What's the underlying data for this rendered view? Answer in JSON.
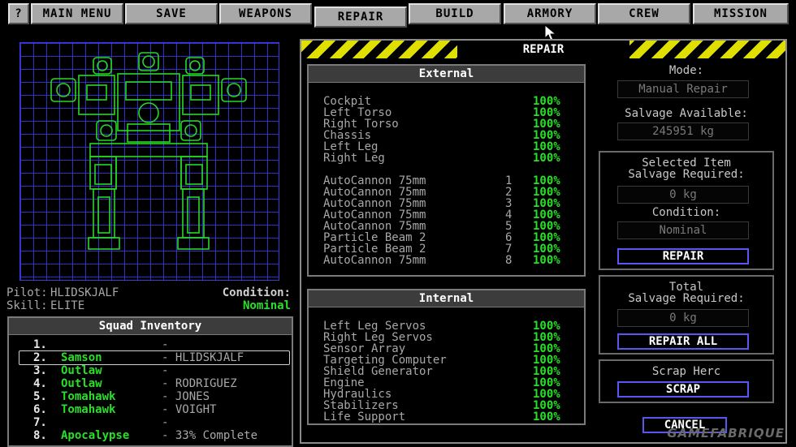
{
  "menu": {
    "help": "?",
    "items": [
      "MAIN MENU",
      "SAVE",
      "WEAPONS",
      "REPAIR",
      "BUILD",
      "ARMORY",
      "CREW",
      "MISSION"
    ]
  },
  "pilot": {
    "pilot_label": "Pilot:",
    "pilot_value": "HLIDSKJALF",
    "skill_label": "Skill:",
    "skill_value": "ELITE",
    "condition_label": "Condition:",
    "condition_value": "Nominal"
  },
  "squad": {
    "title": "Squad Inventory",
    "rows": [
      {
        "num": "1.",
        "name": "",
        "pilot": "-"
      },
      {
        "num": "2.",
        "name": "Samson",
        "pilot": "- HLIDSKJALF"
      },
      {
        "num": "3.",
        "name": "Outlaw",
        "pilot": "-"
      },
      {
        "num": "4.",
        "name": "Outlaw",
        "pilot": "- RODRIGUEZ"
      },
      {
        "num": "5.",
        "name": "Tomahawk",
        "pilot": "- JONES"
      },
      {
        "num": "6.",
        "name": "Tomahawk",
        "pilot": "- VOIGHT"
      },
      {
        "num": "7.",
        "name": "",
        "pilot": "-"
      },
      {
        "num": "8.",
        "name": "Apocalypse",
        "pilot": "- 33% Complete"
      }
    ]
  },
  "repair": {
    "title": "REPAIR",
    "external_title": "External",
    "external": [
      {
        "name": "Cockpit",
        "slot": "",
        "pct": "100%"
      },
      {
        "name": "Left Torso",
        "slot": "",
        "pct": "100%"
      },
      {
        "name": "Right Torso",
        "slot": "",
        "pct": "100%"
      },
      {
        "name": "Chassis",
        "slot": "",
        "pct": "100%"
      },
      {
        "name": "Left Leg",
        "slot": "",
        "pct": "100%"
      },
      {
        "name": "Right Leg",
        "slot": "",
        "pct": "100%"
      },
      {
        "name": "AutoCannon 75mm",
        "slot": "1",
        "pct": "100%"
      },
      {
        "name": "AutoCannon 75mm",
        "slot": "2",
        "pct": "100%"
      },
      {
        "name": "AutoCannon 75mm",
        "slot": "3",
        "pct": "100%"
      },
      {
        "name": "AutoCannon 75mm",
        "slot": "4",
        "pct": "100%"
      },
      {
        "name": "AutoCannon 75mm",
        "slot": "5",
        "pct": "100%"
      },
      {
        "name": "Particle Beam 2",
        "slot": "6",
        "pct": "100%"
      },
      {
        "name": "Particle Beam 2",
        "slot": "7",
        "pct": "100%"
      },
      {
        "name": "AutoCannon 75mm",
        "slot": "8",
        "pct": "100%"
      }
    ],
    "internal_title": "Internal",
    "internal": [
      {
        "name": "Left Leg Servos",
        "pct": "100%"
      },
      {
        "name": "Right Leg Servos",
        "pct": "100%"
      },
      {
        "name": "Sensor Array",
        "pct": "100%"
      },
      {
        "name": "Targeting Computer",
        "pct": "100%"
      },
      {
        "name": "Shield Generator",
        "pct": "100%"
      },
      {
        "name": "Engine",
        "pct": "100%"
      },
      {
        "name": "Hydraulics",
        "pct": "100%"
      },
      {
        "name": "Stabilizers",
        "pct": "100%"
      },
      {
        "name": "Life Support",
        "pct": "100%"
      }
    ],
    "mode_label": "Mode:",
    "mode_value": "Manual Repair",
    "salvage_label": "Salvage Available:",
    "salvage_value": "245951 kg",
    "selected_title_1": "Selected Item",
    "selected_title_2": "Salvage Required:",
    "selected_value": "0 kg",
    "condition_label": "Condition:",
    "condition_value": "Nominal",
    "repair_button": "REPAIR",
    "total_title_1": "Total",
    "total_title_2": "Salvage Required:",
    "total_value": "0 kg",
    "repair_all_button": "REPAIR ALL",
    "scrap_title": "Scrap Herc",
    "scrap_button": "SCRAP",
    "cancel_button": "CANCEL"
  },
  "watermark": "GAMEFABRIQUE",
  "colors": {
    "accent_green": "#28e028",
    "grid_blue": "#3232c8",
    "hazard_yellow": "#e0e000",
    "button_border": "#5858f0"
  }
}
